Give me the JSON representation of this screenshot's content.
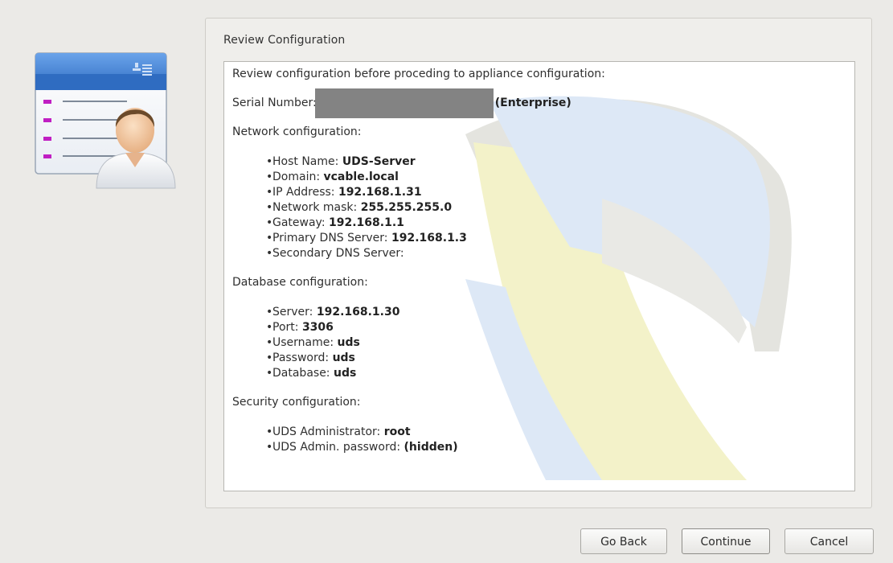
{
  "group": {
    "title": "Review Configuration"
  },
  "review": {
    "intro": "Review configuration before proceding to appliance configuration:",
    "serial_label": "Serial Number:",
    "serial_edition": "(Enterprise)",
    "network": {
      "heading": "Network configuration:",
      "items": [
        {
          "label": "Host Name:",
          "value": "UDS-Server"
        },
        {
          "label": "Domain:",
          "value": "vcable.local"
        },
        {
          "label": "IP Address:",
          "value": "192.168.1.31"
        },
        {
          "label": "Network mask:",
          "value": "255.255.255.0"
        },
        {
          "label": "Gateway:",
          "value": "192.168.1.1"
        },
        {
          "label": "Primary DNS Server:",
          "value": "192.168.1.3"
        },
        {
          "label": "Secondary DNS Server:",
          "value": ""
        }
      ]
    },
    "database": {
      "heading": "Database configuration:",
      "items": [
        {
          "label": "Server:",
          "value": "192.168.1.30"
        },
        {
          "label": "Port:",
          "value": "3306"
        },
        {
          "label": "Username:",
          "value": "uds"
        },
        {
          "label": "Password:",
          "value": "uds"
        },
        {
          "label": "Database:",
          "value": "uds"
        }
      ]
    },
    "security": {
      "heading": "Security configuration:",
      "items": [
        {
          "label": "UDS Administrator:",
          "value": "root"
        },
        {
          "label": "UDS Admin. password:",
          "value": "(hidden)"
        }
      ]
    }
  },
  "buttons": {
    "back": "Go Back",
    "continue": "Continue",
    "cancel": "Cancel"
  },
  "illustration": {
    "icon": "user-profile-card-icon",
    "colors": {
      "header_blue": "#3f7fd2",
      "bullet_magenta": "#c01fc3",
      "shirt": "#f4f4f4",
      "skin": "#f2c8a0",
      "hair": "#6b4a2a"
    }
  },
  "watermark": {
    "icon": "uds-logo-watermark",
    "colors": {
      "yellow": "#f4f3c7",
      "blue": "#d9e6f5",
      "gray": "#e6e6e3"
    }
  }
}
